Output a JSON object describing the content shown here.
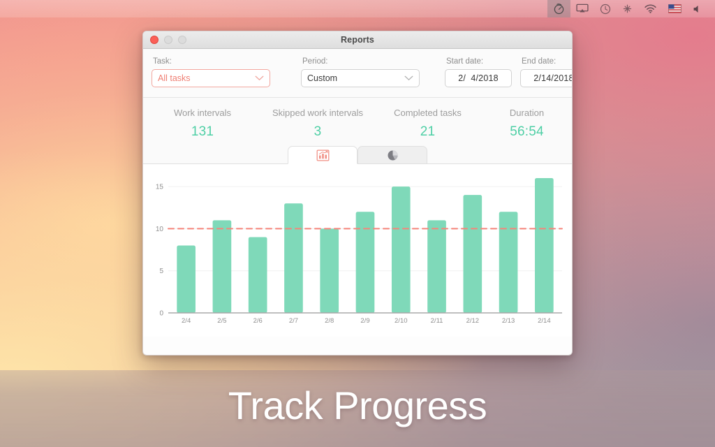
{
  "menubar": {
    "items": [
      {
        "name": "timer-icon",
        "label": "Timer",
        "active": true
      },
      {
        "name": "airplay-icon",
        "label": "AirPlay",
        "active": false
      },
      {
        "name": "clock-icon",
        "label": "Clock",
        "active": false
      },
      {
        "name": "bluetooth-icon",
        "label": "Bluetooth",
        "active": false
      },
      {
        "name": "wifi-icon",
        "label": "Wi-Fi",
        "active": false
      },
      {
        "name": "flag-icon",
        "label": "US Keyboard",
        "active": false
      },
      {
        "name": "volume-icon",
        "label": "Volume",
        "active": false
      }
    ]
  },
  "window": {
    "title": "Reports",
    "traffic_lights": [
      "close",
      "minimize",
      "zoom"
    ]
  },
  "filters": {
    "task": {
      "label": "Task:",
      "value": "All tasks",
      "accent": "#ef7e72"
    },
    "period": {
      "label": "Period:",
      "value": "Custom"
    },
    "start_date": {
      "label": "Start date:",
      "value": "2/  4/2018"
    },
    "end_date": {
      "label": "End date:",
      "value": "2/14/2018"
    }
  },
  "stats": [
    {
      "label": "Work intervals",
      "value": "131"
    },
    {
      "label": "Skipped work intervals",
      "value": "3"
    },
    {
      "label": "Completed tasks",
      "value": "21"
    },
    {
      "label": "Duration",
      "value": "56:54"
    }
  ],
  "stats_color": "#4ecfa5",
  "tabs": [
    {
      "name": "bar-chart-tab",
      "icon": "bar-chart-icon",
      "active": true
    },
    {
      "name": "pie-chart-tab",
      "icon": "pie-chart-icon",
      "active": false
    }
  ],
  "chart_data": {
    "type": "bar",
    "title": "",
    "xlabel": "",
    "ylabel": "",
    "categories": [
      "2/4",
      "2/5",
      "2/6",
      "2/7",
      "2/8",
      "2/9",
      "2/10",
      "2/11",
      "2/12",
      "2/13",
      "2/14"
    ],
    "values": [
      8,
      11,
      9,
      13,
      10,
      12,
      15,
      11,
      14,
      12,
      16
    ],
    "ylim": [
      0,
      16.5
    ],
    "yticks": [
      0,
      5,
      10,
      15
    ],
    "ytick_labels": [
      "0",
      "5",
      "10",
      "15"
    ],
    "grid": true,
    "legend": "none",
    "bar_color": "#7fd9b9",
    "goal_line": {
      "value": 10,
      "color": "#f5857a",
      "style": "dashed"
    }
  },
  "caption": {
    "text": "Track Progress"
  }
}
